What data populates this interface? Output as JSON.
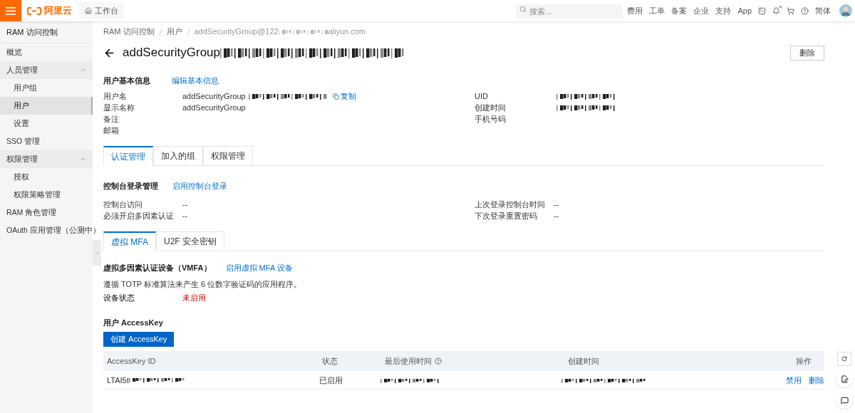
{
  "topbar": {
    "brand": "阿里云",
    "workbench": "工作台",
    "search": {
      "placeholder": "搜索..."
    },
    "links": [
      "费用",
      "工单",
      "备案",
      "企业",
      "支持",
      "App"
    ],
    "notification_dot": true,
    "language": "简体"
  },
  "sidebar": {
    "title": "RAM 访问控制",
    "items": [
      {
        "label": "概览",
        "selected": false
      },
      {
        "label": "人员管理",
        "selected": false,
        "expanded": true,
        "children": [
          {
            "label": "用户组",
            "selected": false
          },
          {
            "label": "用户",
            "selected": true
          },
          {
            "label": "设置",
            "selected": false
          }
        ]
      },
      {
        "label": "SSO 管理",
        "selected": false
      },
      {
        "label": "权限管理",
        "selected": false,
        "expanded": true,
        "children": [
          {
            "label": "授权",
            "selected": false
          },
          {
            "label": "权限策略管理",
            "selected": false
          }
        ]
      },
      {
        "label": "RAM 角色管理",
        "selected": false
      },
      {
        "label": "OAuth 应用管理（公测中）",
        "selected": false
      }
    ]
  },
  "breadcrumb": [
    "RAM 访问控制",
    "用户",
    "addSecurityGroup@122"
  ],
  "breadcrumb_tail": "aliyun.com",
  "page_title": "addSecurityGroup",
  "delete_button": "删除",
  "basic_info": {
    "heading": "用户基本信息",
    "edit_link": "编辑基本信息",
    "left": [
      {
        "label": "用户名",
        "value": "addSecurityGroup",
        "redacted": true,
        "copy": "复制"
      },
      {
        "label": "显示名称",
        "value": "addSecurityGroup",
        "redacted": false
      },
      {
        "label": "备注"
      },
      {
        "label": "邮箱"
      }
    ],
    "right": [
      {
        "label": "UID",
        "redacted": true
      },
      {
        "label": "创建时间",
        "redacted": true
      },
      {
        "label": "手机号码"
      }
    ]
  },
  "tabs": [
    {
      "label": "认证管理",
      "selected": true
    },
    {
      "label": "加入的组",
      "selected": false
    },
    {
      "label": "权限管理",
      "selected": false
    }
  ],
  "console_login": {
    "heading": "控制台登录管理",
    "link": "启用控制台登录",
    "left": [
      {
        "label": "控制台访问",
        "value": "--"
      },
      {
        "label": "必须开启多因素认证",
        "value": "--"
      }
    ],
    "right": [
      {
        "label": "上次登录控制台时间",
        "value": "--"
      },
      {
        "label": "下次登录重置密码",
        "value": "--"
      }
    ]
  },
  "mfa_tabs": [
    {
      "label": "虚拟 MFA",
      "selected": true
    },
    {
      "label": "U2F 安全密钥",
      "selected": false
    }
  ],
  "vmfa": {
    "heading": "虚拟多因素认证设备（VMFA）",
    "link": "启用虚拟 MFA 设备",
    "description": "遵循 TOTP 标准算法来产生 6 位数字验证码的应用程序。",
    "status_label": "设备状态",
    "status": "未启用",
    "status_enabled": false
  },
  "accesskey": {
    "heading": "用户 AccessKey",
    "create_button": "创建 AccessKey",
    "columns": [
      {
        "label": "AccessKey ID"
      },
      {
        "label": "状态"
      },
      {
        "label": "最后使用时间",
        "help": true
      },
      {
        "label": "创建时间"
      },
      {
        "label": "操作"
      }
    ],
    "rows": [
      {
        "id": "LTAI5t",
        "status": "已启用",
        "actions": [
          "禁用",
          "删除"
        ]
      }
    ]
  }
}
